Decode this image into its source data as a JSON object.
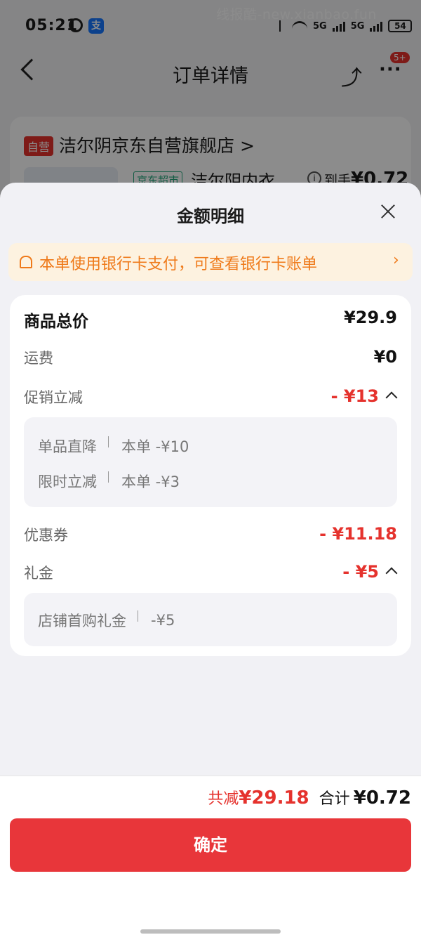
{
  "status_bar": {
    "time": "05:21",
    "watermark": "线报酷-new.xianbao.fun",
    "battery": "54",
    "net1": "5G",
    "net2": "5G"
  },
  "nav": {
    "title": "订单详情",
    "badge": "5+"
  },
  "store": {
    "tag": "自营",
    "name": "洁尔阴京东自营旗舰店 >",
    "market_tag": "京东超市",
    "product_name": "洁尔阴内衣...",
    "arrive_label": "到手",
    "arrive_price": "¥0.72"
  },
  "sheet": {
    "title": "金额明细",
    "notice": "本单使用银行卡支付，可查看银行卡账单",
    "notice_arrow": "›",
    "rows": {
      "total_label": "商品总价",
      "total_val": "¥29.9",
      "shipping_label": "运费",
      "shipping_val": "¥0",
      "promo_label": "促销立减",
      "promo_val": "- ¥13",
      "promo_items": [
        {
          "name": "单品直降",
          "detail": "本单 -¥10"
        },
        {
          "name": "限时立减",
          "detail": "本单 -¥3"
        }
      ],
      "coupon_label": "优惠券",
      "coupon_val": "- ¥11.18",
      "gift_label": "礼金",
      "gift_val": "- ¥5",
      "gift_items": [
        {
          "name": "店铺首购礼金",
          "detail": "-¥5"
        }
      ]
    }
  },
  "footer": {
    "reduce_label": "共减",
    "reduce_val": "¥29.18",
    "sum_label": "合计",
    "sum_val": "¥0.72",
    "confirm": "确定"
  },
  "colors": {
    "accent": "#e5322d",
    "notice": "#ef7a1a",
    "notice_bg": "#fdf2e0",
    "button": "#e8363a"
  }
}
